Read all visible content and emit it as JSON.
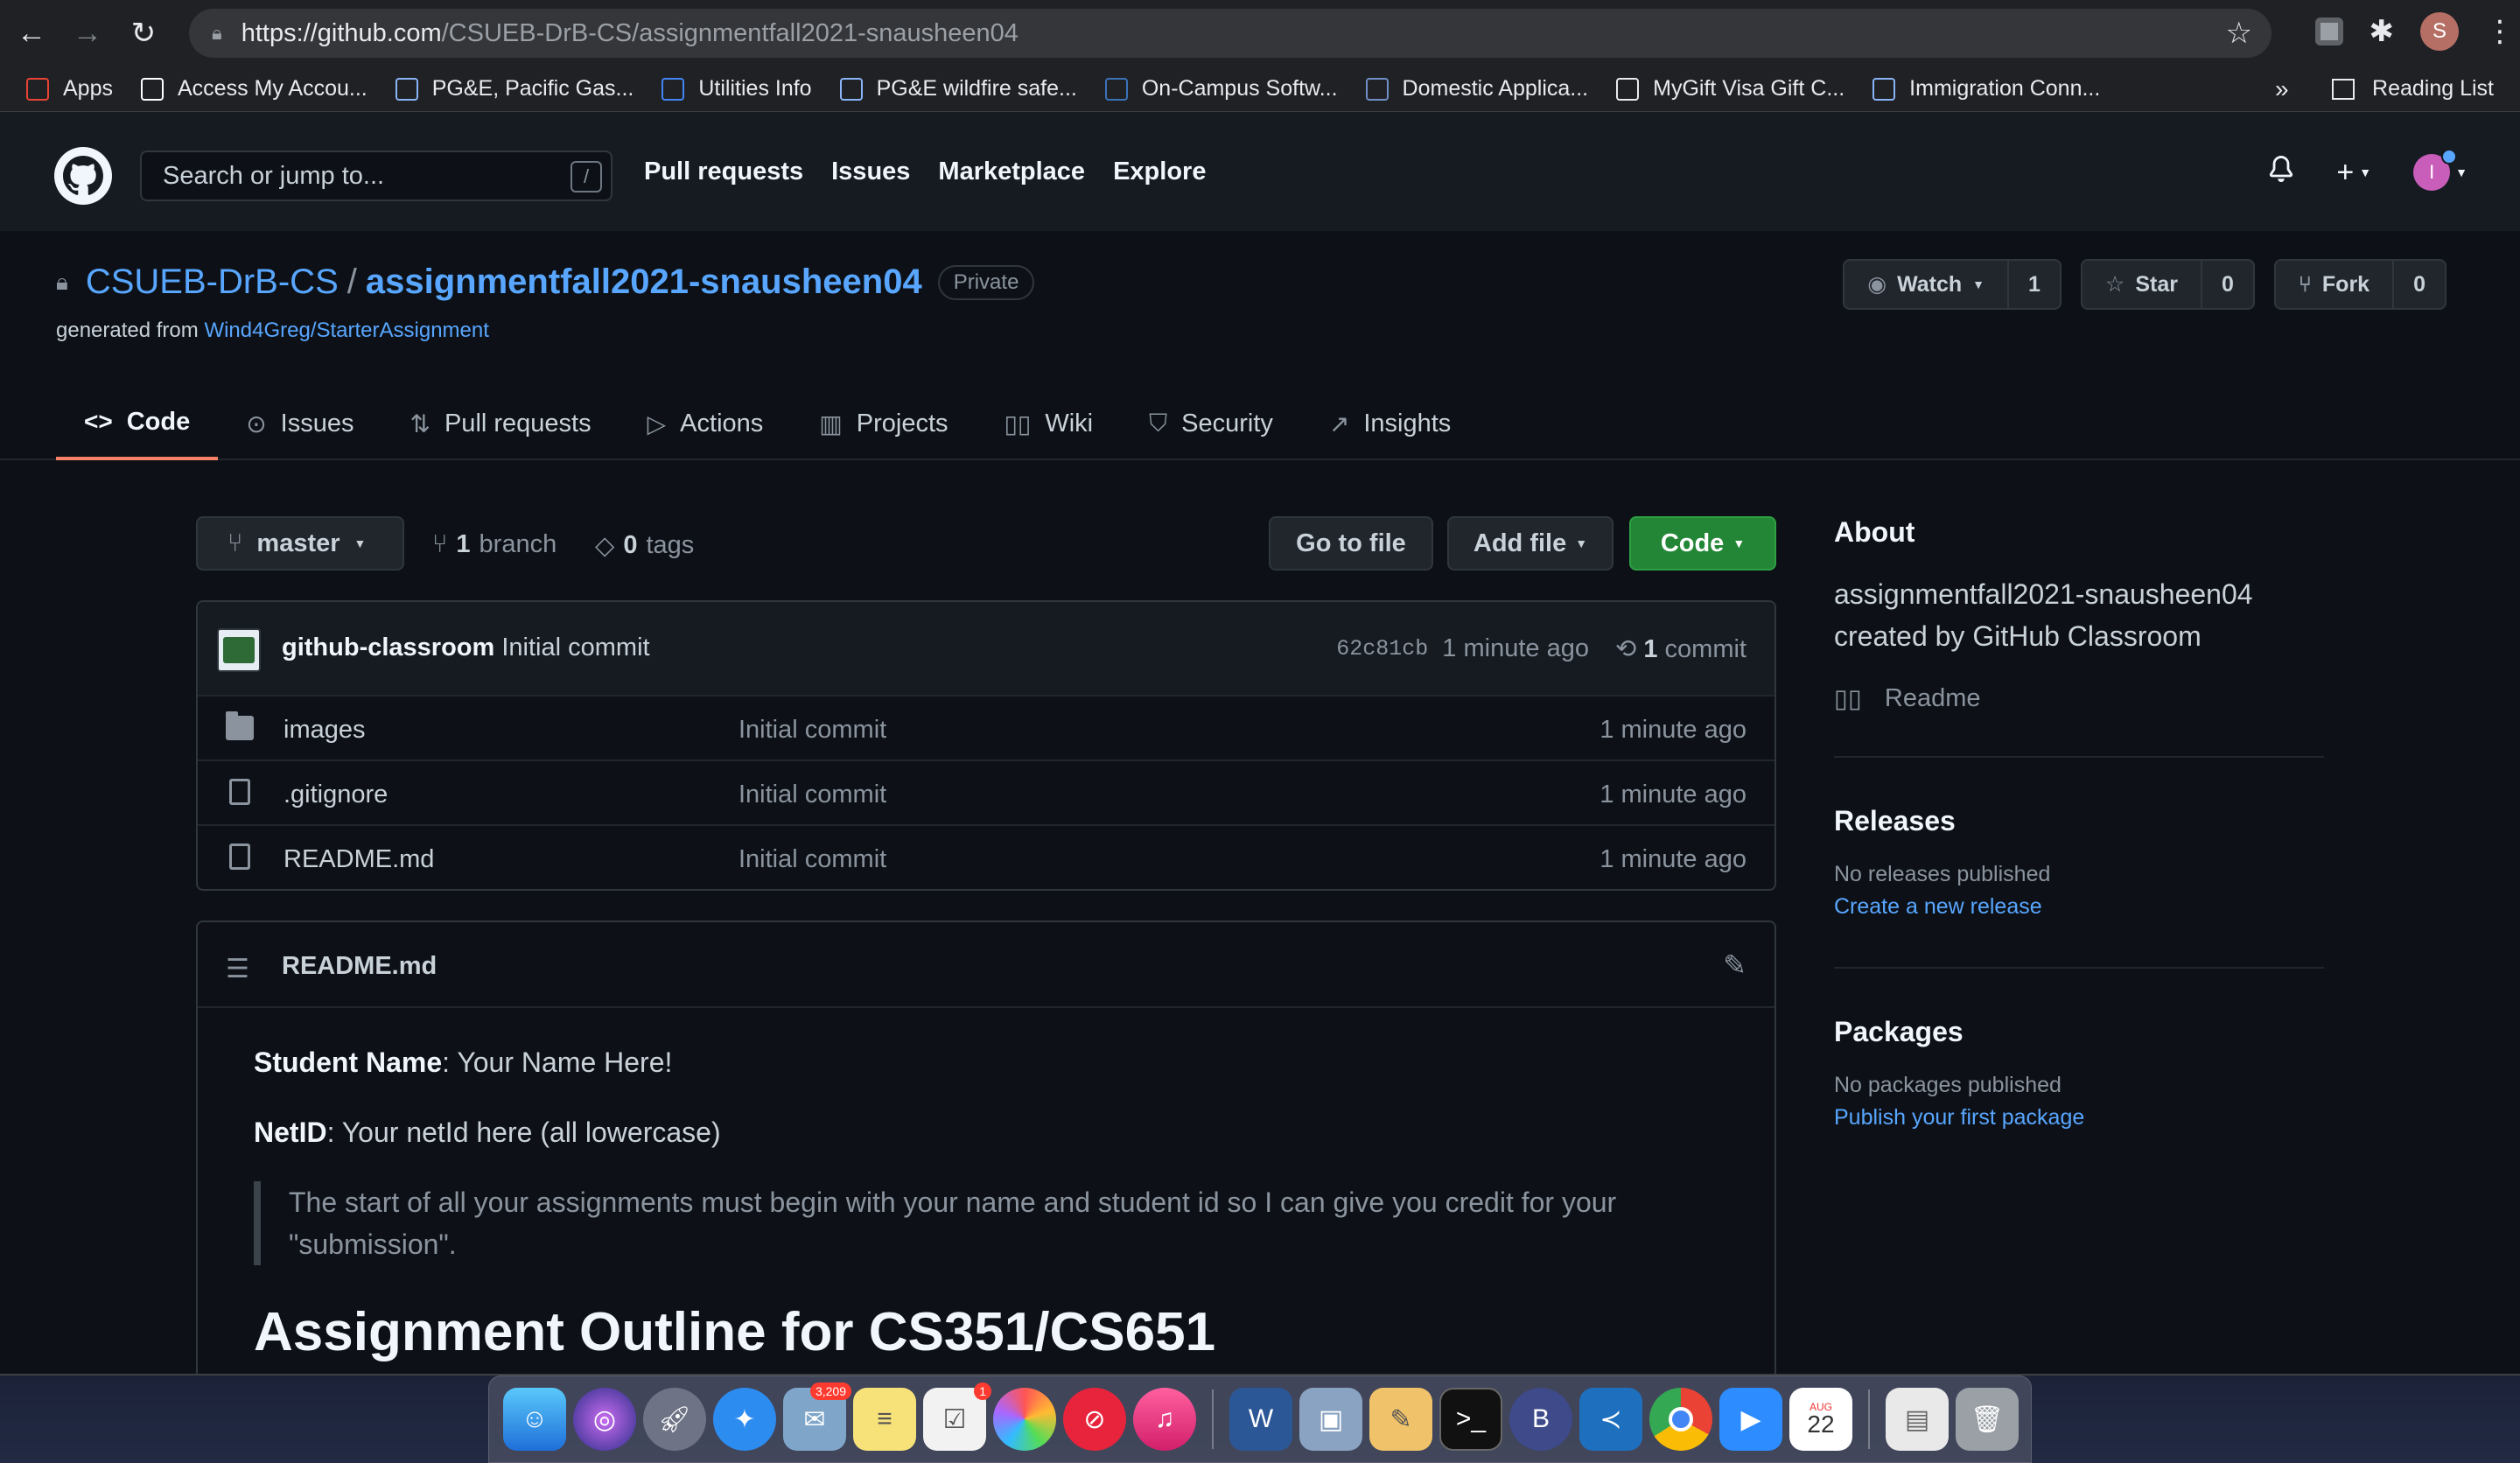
{
  "browser": {
    "url_host": "https://github.com",
    "url_path": "/CSUEB-DrB-CS/assignmentfall2021-snausheen04",
    "profile_initial": "S"
  },
  "bookmarks": {
    "items": [
      {
        "label": "Apps",
        "icon": "apps-grid-icon",
        "color": "#ea4335"
      },
      {
        "label": "Access My Accou...",
        "icon": "x-icon",
        "color": "#ffffff"
      },
      {
        "label": "PG&E, Pacific Gas...",
        "icon": "pge-icon",
        "color": "#8ab4f8"
      },
      {
        "label": "Utilities Info",
        "icon": "house-icon",
        "color": "#4285f4"
      },
      {
        "label": "PG&E wildfire safe...",
        "icon": "pge-icon",
        "color": "#8ab4f8"
      },
      {
        "label": "On-Campus Softw...",
        "icon": "software-icon",
        "color": "#3b73b9"
      },
      {
        "label": "Domestic Applica...",
        "icon": "domestic-icon",
        "color": "#6e8fc7"
      },
      {
        "label": "MyGift Visa Gift C...",
        "icon": "globe-icon",
        "color": "#e8eaed"
      },
      {
        "label": "Immigration Conn...",
        "icon": "circle-icon",
        "color": "#8ab4f8"
      }
    ],
    "more": "»",
    "reading_list": "Reading List"
  },
  "gh_header": {
    "search_placeholder": "Search or jump to...",
    "search_shortcut": "/",
    "nav": [
      "Pull requests",
      "Issues",
      "Marketplace",
      "Explore"
    ]
  },
  "repo": {
    "owner": "CSUEB-DrB-CS",
    "separator": "/",
    "name": "assignmentfall2021-snausheen04",
    "visibility": "Private",
    "generated_prefix": "generated from",
    "generated_link": "Wind4Greg/StarterAssignment",
    "watch_label": "Watch",
    "watch_count": "1",
    "star_label": "Star",
    "star_count": "0",
    "fork_label": "Fork",
    "fork_count": "0",
    "tabs": [
      {
        "label": "Code",
        "icon": "code-icon"
      },
      {
        "label": "Issues",
        "icon": "issue-icon"
      },
      {
        "label": "Pull requests",
        "icon": "pull-request-icon"
      },
      {
        "label": "Actions",
        "icon": "play-icon"
      },
      {
        "label": "Projects",
        "icon": "project-icon"
      },
      {
        "label": "Wiki",
        "icon": "book-icon"
      },
      {
        "label": "Security",
        "icon": "shield-icon"
      },
      {
        "label": "Insights",
        "icon": "graph-icon"
      }
    ]
  },
  "toolbar": {
    "branch": "master",
    "branch_count": "1",
    "branch_word": "branch",
    "tag_count": "0",
    "tag_word": "tags",
    "go_to_file": "Go to file",
    "add_file": "Add file",
    "code": "Code"
  },
  "commit": {
    "author": "github-classroom",
    "message": "Initial commit",
    "sha": "62c81cb",
    "age": "1 minute ago",
    "count": "1",
    "count_word": "commit"
  },
  "files": [
    {
      "name": "images",
      "type": "folder",
      "message": "Initial commit",
      "age": "1 minute ago"
    },
    {
      "name": ".gitignore",
      "type": "file",
      "message": "Initial commit",
      "age": "1 minute ago"
    },
    {
      "name": "README.md",
      "type": "file",
      "message": "Initial commit",
      "age": "1 minute ago"
    }
  ],
  "readme": {
    "title": "README.md",
    "student_label": "Student Name",
    "student_value": ": Your Name Here!",
    "netid_label": "NetID",
    "netid_value": ": Your netId here (all lowercase)",
    "quote": "The start of all your assignments must begin with your name and student id so I can give you credit for your \"submission\".",
    "heading": "Assignment Outline for CS351/CS651"
  },
  "sidebar": {
    "about_title": "About",
    "about_desc": "assignmentfall2021-snausheen04 created by GitHub Classroom",
    "readme_link": "Readme",
    "releases_title": "Releases",
    "releases_empty": "No releases published",
    "releases_link": "Create a new release",
    "packages_title": "Packages",
    "packages_empty": "No packages published",
    "packages_link": "Publish your first package"
  },
  "dock": {
    "mail_badge": "3,209",
    "reminders_badge": "1",
    "calendar_month": "AUG",
    "calendar_day": "22"
  },
  "colors": {
    "accent_link": "#58a6ff",
    "tab_underline": "#f78166",
    "code_button": "#238636"
  }
}
